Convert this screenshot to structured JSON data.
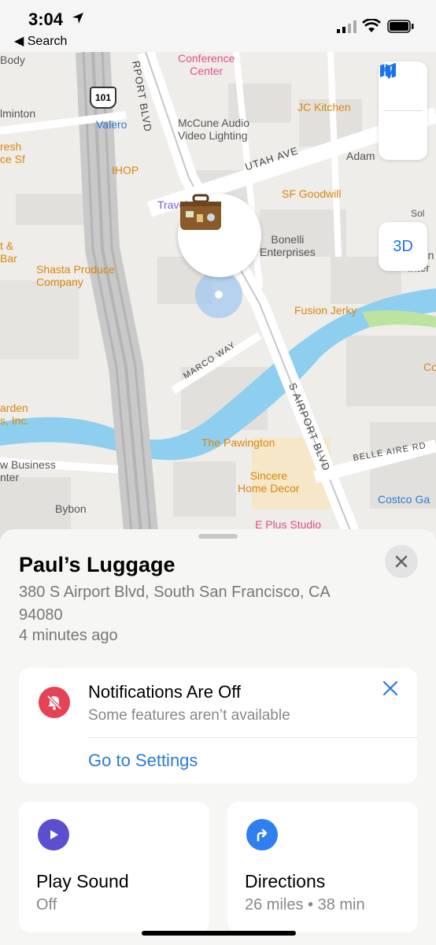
{
  "status_bar": {
    "time": "3:04",
    "back_label": "Search"
  },
  "map": {
    "labels": {
      "body": "Body",
      "conference": "Conference\nCenter",
      "ilminton": "lminton",
      "valero": "Valero",
      "mccune": "McCune Audio\nVideo Lighting",
      "jc_kitchen": "JC Kitchen",
      "resh": "resh\nce Sf",
      "ihop": "IHOP",
      "travel": "Travel",
      "adam": "Adam",
      "sf_goodwill": "SF Goodwill",
      "bonelli": "Bonelli\nEnterprises",
      "zipline": "Ziplin\nInter",
      "t_bar": "t &\nBar",
      "shasta": "Shasta Produce\nCompany",
      "fusion": "Fusion Jerky",
      "arden": "arden\ns, Inc.",
      "pawington": "The Pawington",
      "w_business": "w Business\nnter",
      "sincere": "Sincere\nHome Decor",
      "bybon": "Bybon",
      "costco": "Costco Ga",
      "eplus": "E Plus Studio",
      "co": "Co",
      "sol": "Sol"
    },
    "roads": {
      "airport_top": "RPORT BLVD",
      "utah": "UTAH AVE",
      "marco": "MARCO WAY",
      "airport_bottom": "S AIRPORT BLVD",
      "belle": "BELLE AIRE RD",
      "highway": "101"
    },
    "controls": {
      "three_d": "3D"
    }
  },
  "sheet": {
    "title": "Paul’s Luggage",
    "address": "380 S Airport Blvd, South San Francisco, CA  94080",
    "updated": "4 minutes ago",
    "notification": {
      "title": "Notifications Are Off",
      "subtitle": "Some features aren’t available",
      "link": "Go to Settings"
    },
    "actions": [
      {
        "title": "Play Sound",
        "subtitle": "Off"
      },
      {
        "title": "Directions",
        "subtitle": "26 miles • 38 min"
      }
    ]
  },
  "colors": {
    "accent": "#2a7bd5",
    "alert": "#e54355",
    "sound": "#5b4fcf",
    "directions": "#2f7ff0"
  }
}
